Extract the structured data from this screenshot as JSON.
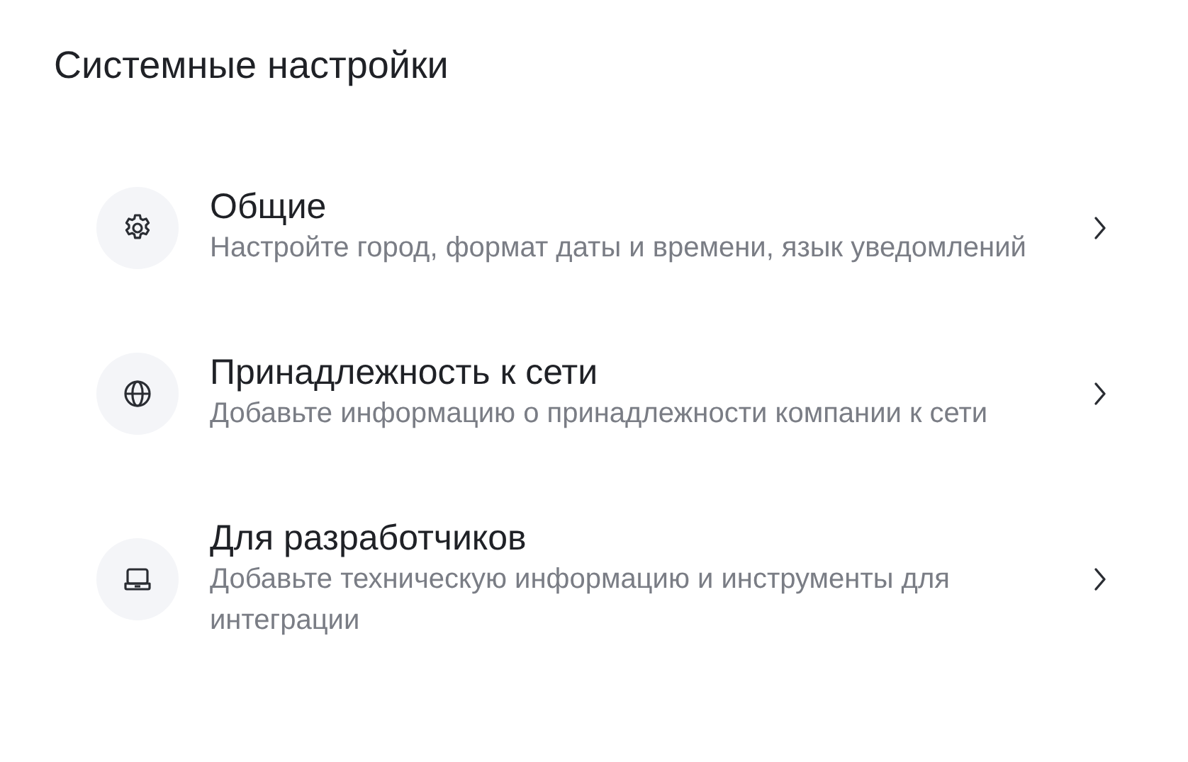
{
  "title": "Системные настройки",
  "items": [
    {
      "label": "Общие",
      "description": "Настройте город, формат даты и времени, язык уведомлений"
    },
    {
      "label": "Принадлежность к сети",
      "description": "Добавьте информацию о принадлежности компании к сети"
    },
    {
      "label": "Для разработчиков",
      "description": "Добавьте техническую информацию и инструменты для интеграции"
    }
  ]
}
